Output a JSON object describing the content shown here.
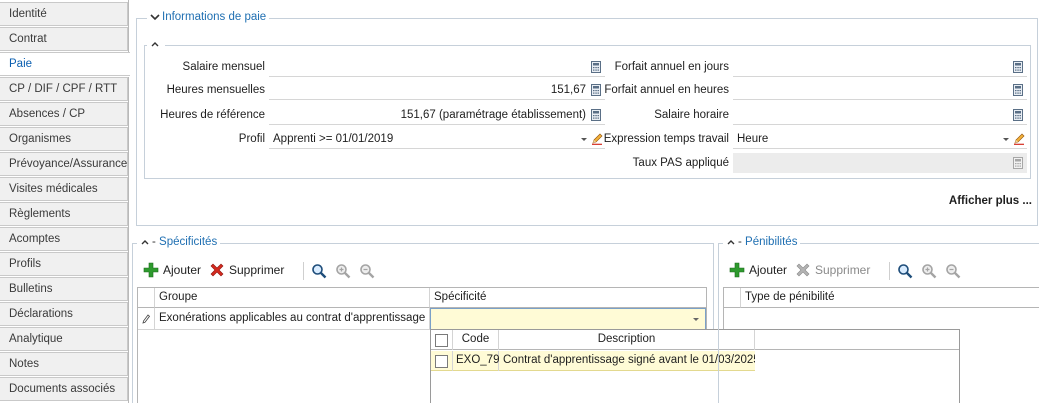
{
  "tabs": [
    {
      "label": "Identité"
    },
    {
      "label": "Contrat"
    },
    {
      "label": "Paie"
    },
    {
      "label": "CP / DIF / CPF / RTT"
    },
    {
      "label": "Absences / CP"
    },
    {
      "label": "Organismes"
    },
    {
      "label": "Prévoyance/Assurance"
    },
    {
      "label": "Visites médicales"
    },
    {
      "label": "Règlements"
    },
    {
      "label": "Acomptes"
    },
    {
      "label": "Profils"
    },
    {
      "label": "Bulletins"
    },
    {
      "label": "Déclarations"
    },
    {
      "label": "Analytique"
    },
    {
      "label": "Notes"
    },
    {
      "label": "Documents associés"
    }
  ],
  "paie": {
    "title": "Informations de paie",
    "salaire_mensuel": {
      "label": "Salaire mensuel",
      "value": ""
    },
    "heures_mensuelles": {
      "label": "Heures mensuelles",
      "value": "151,67"
    },
    "heures_reference": {
      "label": "Heures de référence",
      "value": "151,67 (paramétrage établissement)"
    },
    "profil": {
      "label": "Profil",
      "value": "Apprenti >= 01/01/2019"
    },
    "forfait_jours": {
      "label": "Forfait annuel en jours",
      "value": ""
    },
    "forfait_heures": {
      "label": "Forfait annuel en heures",
      "value": ""
    },
    "salaire_horaire": {
      "label": "Salaire horaire",
      "value": ""
    },
    "expression_temps": {
      "label": "Expression temps travail",
      "value": "Heure"
    },
    "taux_pas": {
      "label": "Taux PAS appliqué",
      "value": ""
    },
    "afficher_plus": "Afficher plus ..."
  },
  "specificites": {
    "title": "Spécificités",
    "add_label": "Ajouter",
    "delete_label": "Supprimer",
    "columns": [
      "Groupe",
      "Spécificité"
    ],
    "row": {
      "groupe": "Exonérations applicables au contrat d'apprentissage",
      "specificite": ""
    },
    "popup": {
      "columns": [
        "Code",
        "Description"
      ],
      "rows": [
        {
          "code": "EXO_79",
          "description": "Contrat d'apprentissage signé avant le 01/03/2025"
        }
      ]
    }
  },
  "penibilites": {
    "title": "Pénibilités",
    "add_label": "Ajouter",
    "delete_label": "Supprimer",
    "columns": [
      "Type de pénibilité"
    ]
  },
  "colors": {
    "accent": "#1f6fb2",
    "row_highlight": "#fffbd6",
    "add_green": "#2e9a2e",
    "delete_red": "#d42a1f"
  }
}
